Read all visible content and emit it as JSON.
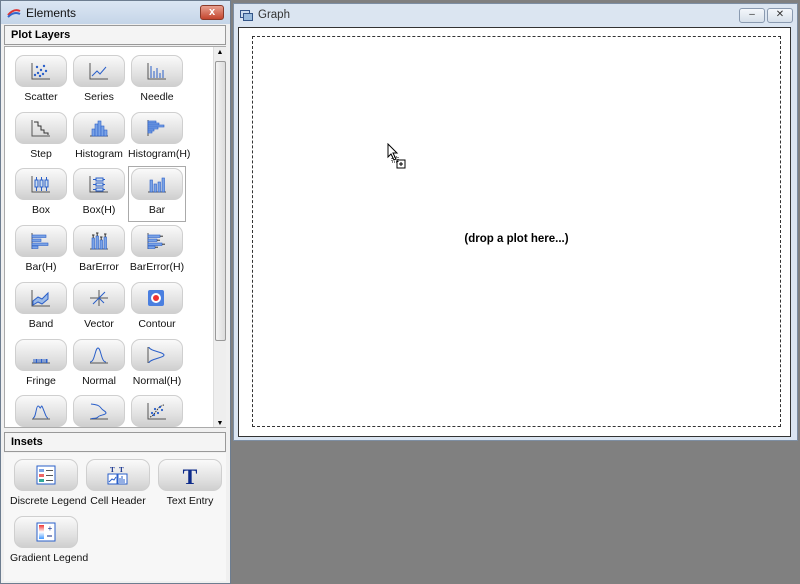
{
  "elements_panel": {
    "title": "Elements",
    "close_label": "x",
    "plot_layers": {
      "header": "Plot Layers",
      "items": [
        {
          "label": "Scatter",
          "icon": "scatter-icon"
        },
        {
          "label": "Series",
          "icon": "series-icon"
        },
        {
          "label": "Needle",
          "icon": "needle-icon"
        },
        {
          "label": "Step",
          "icon": "step-icon"
        },
        {
          "label": "Histogram",
          "icon": "histogram-icon"
        },
        {
          "label": "Histogram(H)",
          "icon": "histogram-h-icon"
        },
        {
          "label": "Box",
          "icon": "box-icon"
        },
        {
          "label": "Box(H)",
          "icon": "box-h-icon"
        },
        {
          "label": "Bar",
          "icon": "bar-icon",
          "selected": true
        },
        {
          "label": "Bar(H)",
          "icon": "bar-h-icon"
        },
        {
          "label": "BarError",
          "icon": "bar-error-icon"
        },
        {
          "label": "BarError(H)",
          "icon": "bar-error-h-icon"
        },
        {
          "label": "Band",
          "icon": "band-icon"
        },
        {
          "label": "Vector",
          "icon": "vector-icon"
        },
        {
          "label": "Contour",
          "icon": "contour-icon"
        },
        {
          "label": "Fringe",
          "icon": "fringe-icon"
        },
        {
          "label": "Normal",
          "icon": "normal-icon"
        },
        {
          "label": "Normal(H)",
          "icon": "normal-h-icon"
        },
        {
          "label": "",
          "icon": "density-icon"
        },
        {
          "label": "",
          "icon": "density-h-icon"
        },
        {
          "label": "",
          "icon": "regression-icon"
        }
      ]
    },
    "insets": {
      "header": "Insets",
      "items": [
        {
          "label": "Discrete Legend",
          "icon": "discrete-legend-icon"
        },
        {
          "label": "Cell Header",
          "icon": "cell-header-icon"
        },
        {
          "label": "Text Entry",
          "icon": "text-entry-icon"
        },
        {
          "label": "Gradient Legend",
          "icon": "gradient-legend-icon"
        }
      ]
    }
  },
  "graph_window": {
    "title": "Graph",
    "minimize_label": "–",
    "close_label": "✕",
    "placeholder": "(drop a plot here...)"
  },
  "colors": {
    "accent": "#2a5fc9",
    "text_entry": "#0d2a8a"
  }
}
